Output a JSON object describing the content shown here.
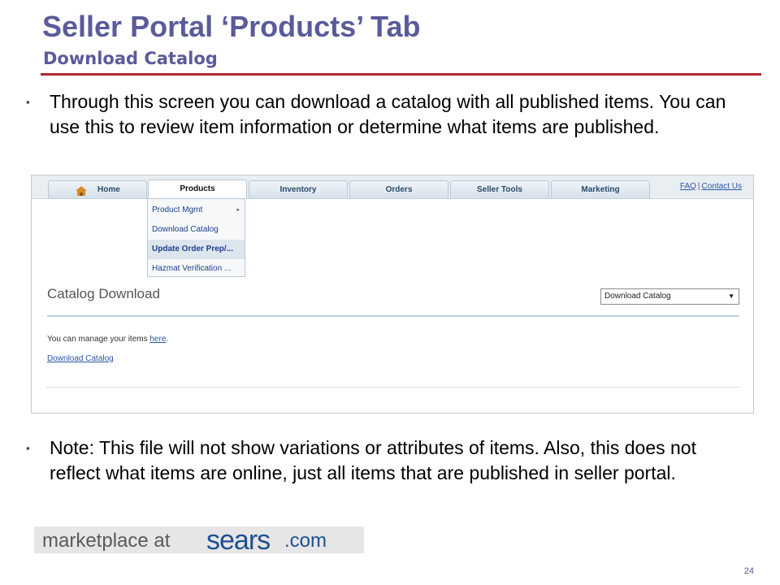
{
  "slide": {
    "title": "Seller Portal ‘Products’ Tab",
    "subtitle": "Download Catalog",
    "bullets": [
      "Through this screen you can download a catalog with all published items. You can use this to review item information or determine what items are published.",
      "Note: This file will not show variations or attributes of items. Also, this does not reflect what items are online, just all items that are published in seller portal."
    ],
    "bullet_mark": "▪",
    "page_number": "24",
    "logo": {
      "part1": "marketplace at",
      "part2": "sears",
      "part3": ".com"
    }
  },
  "portal": {
    "tabs": [
      "Home",
      "Products",
      "Inventory",
      "Orders",
      "Seller Tools",
      "Marketing"
    ],
    "active_tab": "Products",
    "top_links": {
      "faq": "FAQ",
      "separator": "|",
      "contact": "Contact Us"
    },
    "products_menu": [
      {
        "label": "Product Mgmt",
        "submenu": true
      },
      {
        "label": "Download Catalog",
        "submenu": false
      },
      {
        "label": "Update Order Prep/...",
        "submenu": false,
        "highlighted": true
      },
      {
        "label": "Hazmat Verification ...",
        "submenu": false
      }
    ],
    "submenu_arrow": "▸",
    "page_title": "Catalog Download",
    "select": {
      "value": "Download Catalog",
      "caret": "▼"
    },
    "manage_text": "You can manage your items",
    "manage_link": "here",
    "manage_period": ".",
    "download_link": "Download Catalog"
  },
  "colors": {
    "title": "#5b5b9a",
    "rule": "#b0262d",
    "link": "#2a56a8",
    "logo_blue": "#1d4f91"
  },
  "icons": {
    "home": "home-icon"
  }
}
